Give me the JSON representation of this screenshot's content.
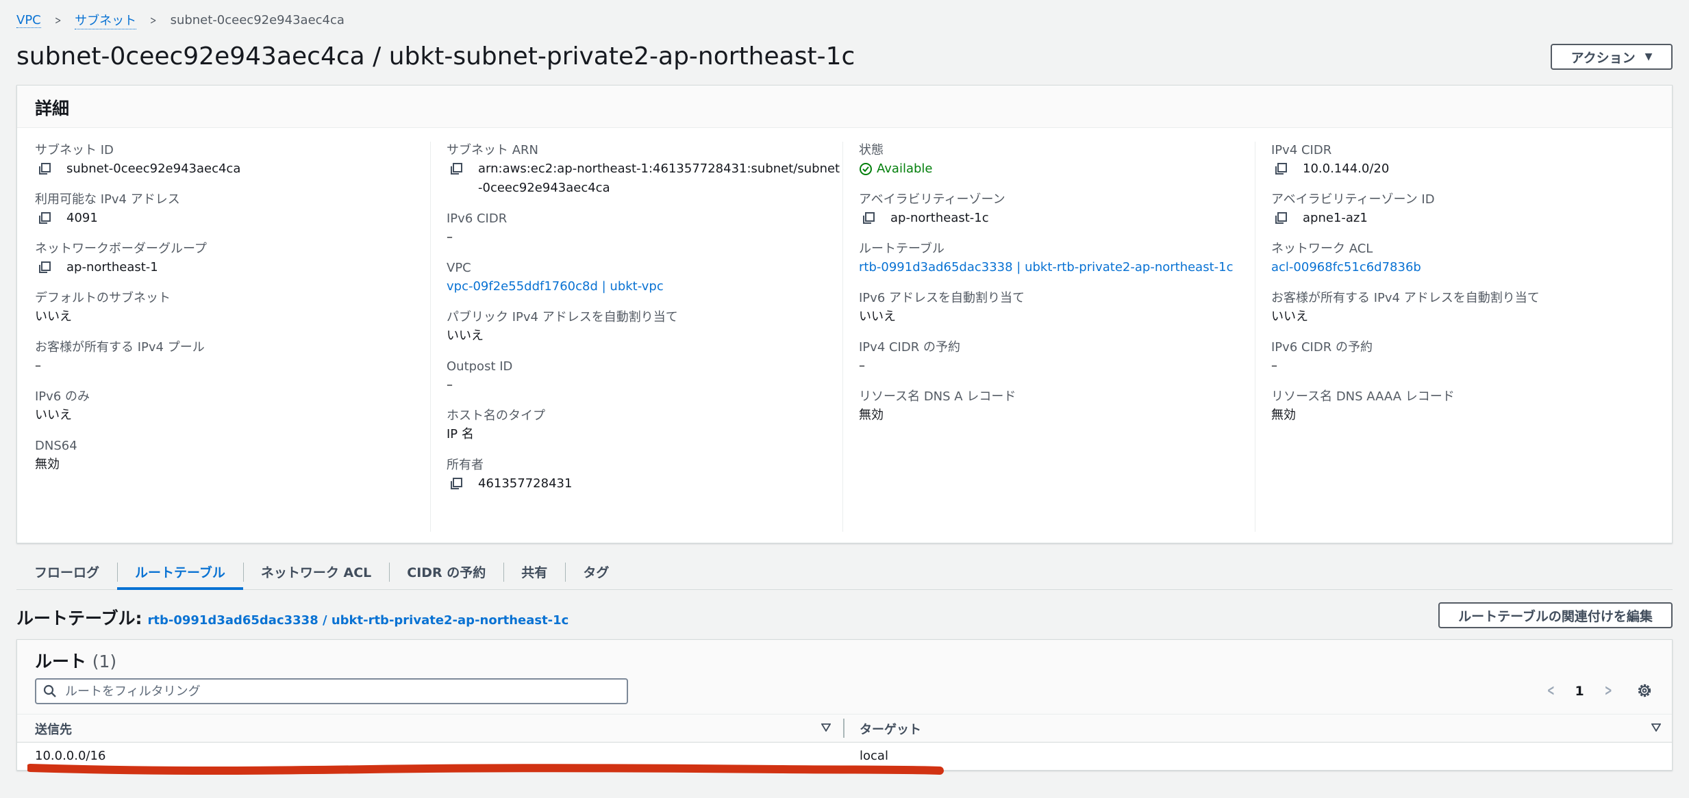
{
  "breadcrumb": {
    "vpc": "VPC",
    "subnets": "サブネット",
    "current": "subnet-0ceec92e943aec4ca"
  },
  "page_title": "subnet-0ceec92e943aec4ca / ubkt-subnet-private2-ap-northeast-1c",
  "actions_button": "アクション",
  "details": {
    "title": "詳細",
    "columns": [
      [
        {
          "label": "サブネット ID",
          "value": "subnet-0ceec92e943aec4ca",
          "copy": true
        },
        {
          "label": "利用可能な IPv4 アドレス",
          "value": "4091",
          "copy": true
        },
        {
          "label": "ネットワークボーダーグループ",
          "value": "ap-northeast-1",
          "copy": true
        },
        {
          "label": "デフォルトのサブネット",
          "value": "いいえ"
        },
        {
          "label": "お客様が所有する IPv4 プール",
          "value": "–"
        },
        {
          "label": "IPv6 のみ",
          "value": "いいえ"
        },
        {
          "label": "DNS64",
          "value": "無効"
        }
      ],
      [
        {
          "label": "サブネット ARN",
          "value": "arn:aws:ec2:ap-northeast-1:461357728431:subnet/subnet-0ceec92e943aec4ca",
          "copy": true
        },
        {
          "label": "IPv6 CIDR",
          "value": "–"
        },
        {
          "label": "VPC",
          "value": "vpc-09f2e55ddf1760c8d | ubkt-vpc",
          "link": true
        },
        {
          "label": "パブリック IPv4 アドレスを自動割り当て",
          "value": "いいえ"
        },
        {
          "label": "Outpost ID",
          "value": "–"
        },
        {
          "label": "ホスト名のタイプ",
          "value": "IP 名"
        },
        {
          "label": "所有者",
          "value": "461357728431",
          "copy": true
        }
      ],
      [
        {
          "label": "状態",
          "value": "Available",
          "status": true
        },
        {
          "label": "アベイラビリティーゾーン",
          "value": "ap-northeast-1c",
          "copy": true
        },
        {
          "label": "ルートテーブル",
          "value": "rtb-0991d3ad65dac3338 | ubkt-rtb-private2-ap-northeast-1c",
          "link": true
        },
        {
          "label": "IPv6 アドレスを自動割り当て",
          "value": "いいえ"
        },
        {
          "label": "IPv4 CIDR の予約",
          "value": "–"
        },
        {
          "label": "リソース名 DNS A レコード",
          "value": "無効"
        }
      ],
      [
        {
          "label": "IPv4 CIDR",
          "value": "10.0.144.0/20",
          "copy": true
        },
        {
          "label": "アベイラビリティーゾーン ID",
          "value": "apne1-az1",
          "copy": true
        },
        {
          "label": "ネットワーク ACL",
          "value": "acl-00968fc51c6d7836b",
          "link": true
        },
        {
          "label": "お客様が所有する IPv4 アドレスを自動割り当て",
          "value": "いいえ"
        },
        {
          "label": "IPv6 CIDR の予約",
          "value": "–"
        },
        {
          "label": "リソース名 DNS AAAA レコード",
          "value": "無効"
        }
      ]
    ]
  },
  "tabs": [
    "フローログ",
    "ルートテーブル",
    "ネットワーク ACL",
    "CIDR の予約",
    "共有",
    "タグ"
  ],
  "active_tab": "ルートテーブル",
  "route_table": {
    "label": "ルートテーブル:",
    "link": "rtb-0991d3ad65dac3338 / ubkt-rtb-private2-ap-northeast-1c",
    "edit_button": "ルートテーブルの関連付けを編集"
  },
  "routes": {
    "title": "ルート",
    "count": "(1)",
    "search_placeholder": "ルートをフィルタリング",
    "page": "1",
    "columns": [
      "送信先",
      "ターゲット"
    ],
    "rows": [
      {
        "destination": "10.0.0.0/16",
        "target": "local"
      }
    ]
  },
  "colors": {
    "link": "#0972d3",
    "status_ok": "#037f0c",
    "annotation": "#d13212"
  },
  "icons": [
    "chevron-right-icon",
    "caret-down-icon",
    "copy-icon",
    "check-circle-icon",
    "search-icon",
    "chevron-left-icon",
    "gear-icon",
    "sort-icon"
  ]
}
